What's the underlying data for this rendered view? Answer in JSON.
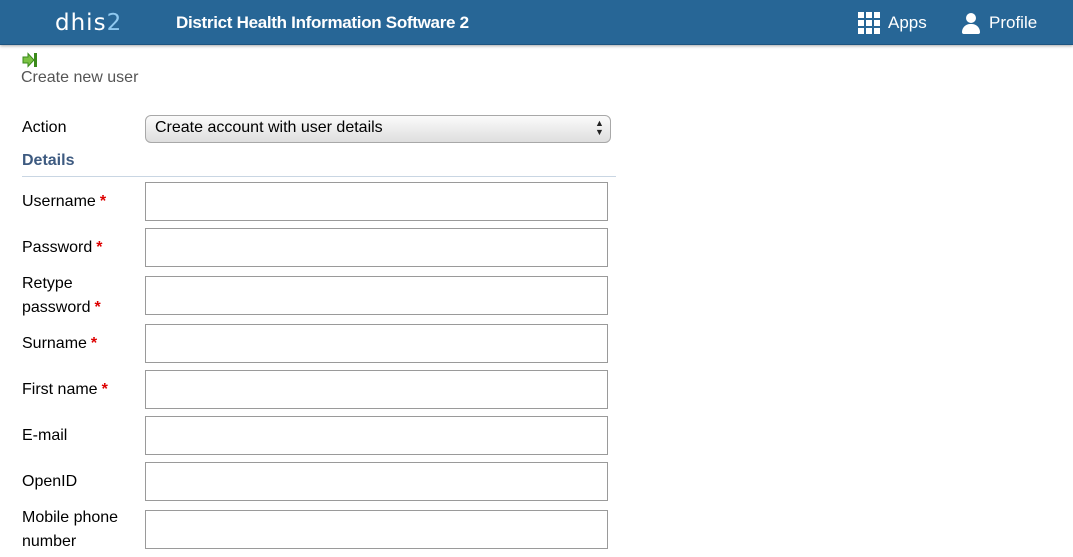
{
  "header": {
    "logo_main": "dhis",
    "logo_accent": "2",
    "title": "District Health Information Software 2",
    "apps_label": "Apps",
    "profile_label": "Profile"
  },
  "page": {
    "back_icon": "green-arrow-right-icon",
    "title": "Create new user"
  },
  "action": {
    "label": "Action",
    "selected": "Create account with user details"
  },
  "section": {
    "title": "Details"
  },
  "fields": {
    "username": {
      "label": "Username",
      "required": "*",
      "value": ""
    },
    "password": {
      "label": "Password",
      "required": "*",
      "value": ""
    },
    "retype_password": {
      "label_line1": "Retype",
      "label_line2": "password",
      "required": "*",
      "value": ""
    },
    "surname": {
      "label": "Surname",
      "required": "*",
      "value": ""
    },
    "first_name": {
      "label": "First name",
      "required": "*",
      "value": ""
    },
    "email": {
      "label": "E-mail",
      "value": ""
    },
    "openid": {
      "label": "OpenID",
      "value": ""
    },
    "mobile": {
      "label_line1": "Mobile phone",
      "label_line2": "number",
      "value": ""
    }
  },
  "colors": {
    "header_bg": "#276696",
    "required": "#dd0000",
    "section_title": "#3d5a80"
  }
}
